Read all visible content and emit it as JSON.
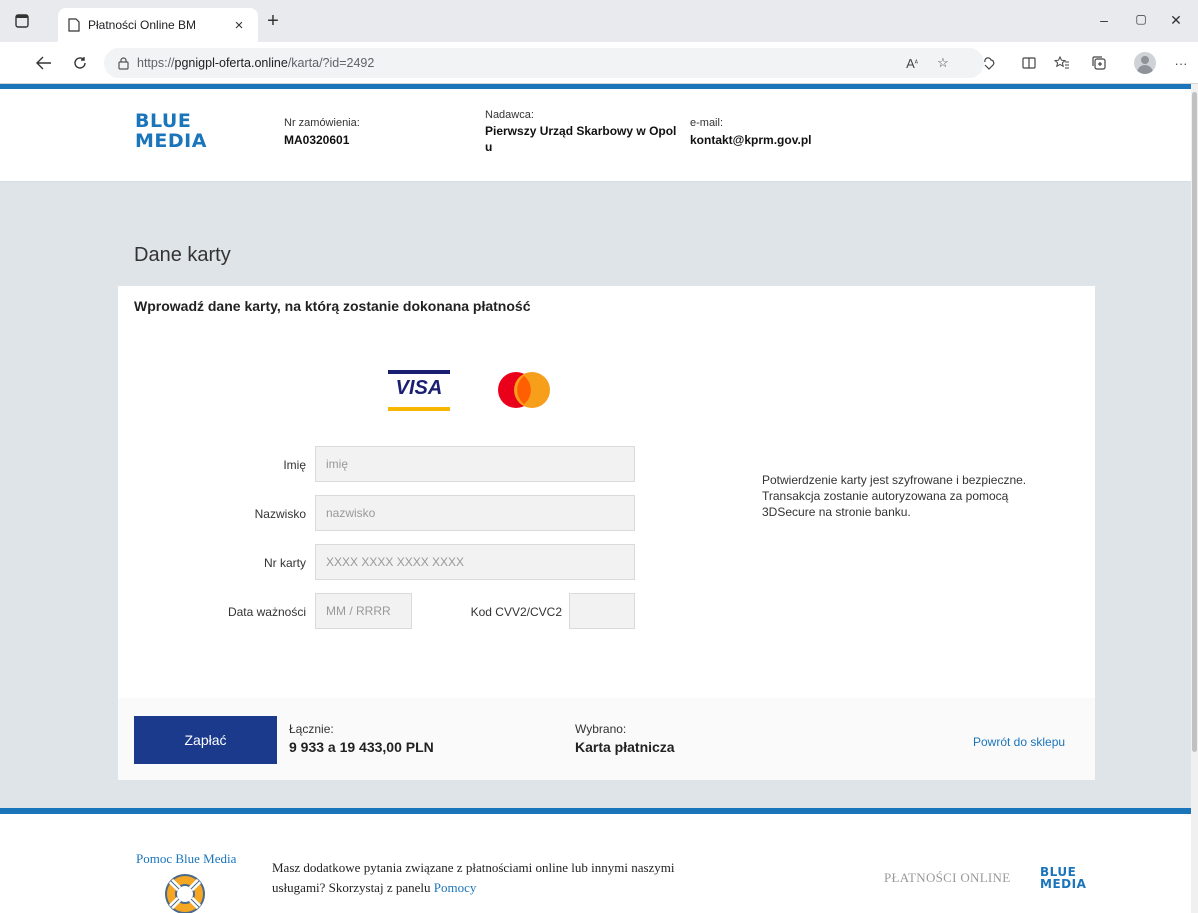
{
  "browser": {
    "tab_title": "Płatności Online BM",
    "url_prefix": "https://",
    "url_host": "pgnigpl-oferta.online",
    "url_path": "/karta/?id=2492"
  },
  "header": {
    "logo_line1": "BLUE",
    "logo_line2": "MEDIA",
    "order_label": "Nr zamówienia:",
    "order_value": "MA0320601",
    "sender_label": "Nadawca:",
    "sender_line1": "Pierwszy Urząd Skarbowy w Opol",
    "sender_line2": "u",
    "email_label": "e-mail:",
    "email_value": "kontakt@kprm.gov.pl"
  },
  "main": {
    "section_title": "Dane karty",
    "card_title": "Wprowadź dane karty, na którą zostanie dokonana płatność",
    "visa_text": "VISA",
    "fields": {
      "first_name_label": "Imię",
      "first_name_placeholder": "imię",
      "last_name_label": "Nazwisko",
      "last_name_placeholder": "nazwisko",
      "card_number_label": "Nr karty",
      "card_number_placeholder": "XXXX XXXX XXXX XXXX",
      "expiry_label": "Data ważności",
      "expiry_placeholder": "MM / RRRR",
      "cvv_label": "Kod CVV2/CVC2",
      "cvv_placeholder": ""
    },
    "info_text": "Potwierdzenie karty jest szyfrowane i bezpieczne. Transakcja zostanie autoryzowana za pomocą 3DSecure na stronie banku.",
    "pay_button": "Zapłać",
    "total_label": "Łącznie:",
    "total_value": "9 933 a 19 433,00 PLN",
    "selected_label": "Wybrano:",
    "selected_value": "Karta płatnicza",
    "back_link": "Powrót do sklepu"
  },
  "footer": {
    "help_title": "Pomoc Blue Media",
    "help_text": "Masz dodatkowe pytania związane z płatnościami online lub innymi naszymi usługami? Skorzystaj z panelu ",
    "help_link": "Pomocy",
    "payments_online": "PŁATNOŚCI ONLINE",
    "logo_line1": "BLUE",
    "logo_line2": "MEDIA"
  },
  "colors": {
    "brand_blue": "#1b75bb",
    "pay_button": "#1b3a8c",
    "visa_blue": "#1a1f71",
    "visa_gold": "#f7b600",
    "mc_red": "#eb001b",
    "mc_orange": "#f79e1b"
  },
  "icons": {
    "tab_actions": "tab-actions-icon",
    "page": "document-icon",
    "lock": "lock-icon",
    "read_aloud": "read-aloud-icon",
    "favorite": "star-icon",
    "refresh": "refresh-icon"
  }
}
